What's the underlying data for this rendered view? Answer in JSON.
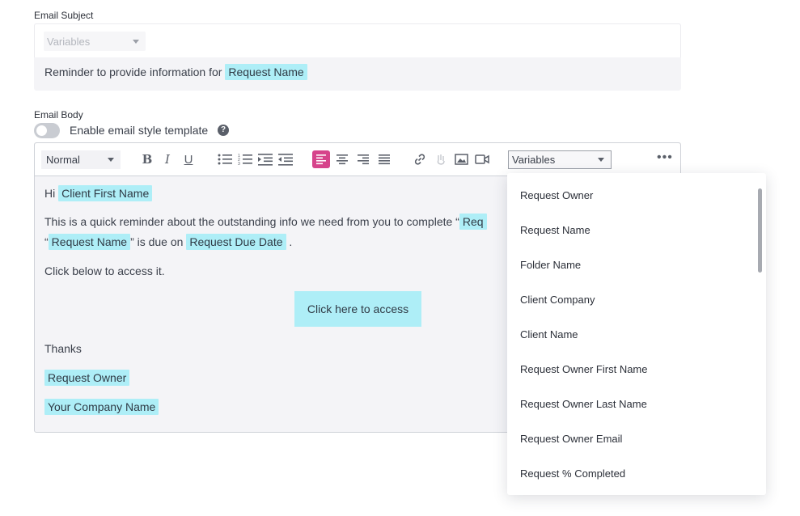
{
  "subject": {
    "label": "Email Subject",
    "variables_placeholder": "Variables",
    "text_prefix": "Reminder to provide information for",
    "tag": "Request Name"
  },
  "body": {
    "label": "Email Body",
    "toggle_label": "Enable email style template",
    "toggle_on": false
  },
  "toolbar": {
    "format_value": "Normal",
    "bold": "B",
    "italic": "I",
    "underline": "U",
    "variables_label": "Variables",
    "more": "•••"
  },
  "content": {
    "greeting": "Hi",
    "greeting_tag": "Client First Name",
    "line1_prefix": "This is a quick reminder about the outstanding info we need from you to complete “",
    "line1_tag_cut": "Req",
    "line2_open": "“",
    "line2_tag1": "Request Name",
    "line2_mid": "” is due on",
    "line2_tag2": "Request Due Date",
    "line2_end": ".",
    "line3": "Click below to access it.",
    "cta_label": "Click here to access",
    "thanks": "Thanks",
    "sig_tag1": "Request Owner",
    "sig_tag2": "Your Company Name"
  },
  "dropdown": {
    "items": [
      "Request Owner",
      "Request Name",
      "Folder Name",
      "Client Company",
      "Client Name",
      "Request Owner First Name",
      "Request Owner Last Name",
      "Request Owner Email",
      "Request % Completed"
    ]
  },
  "colors": {
    "tag_bg": "#aeeef7",
    "active_align": "#d6448b"
  }
}
